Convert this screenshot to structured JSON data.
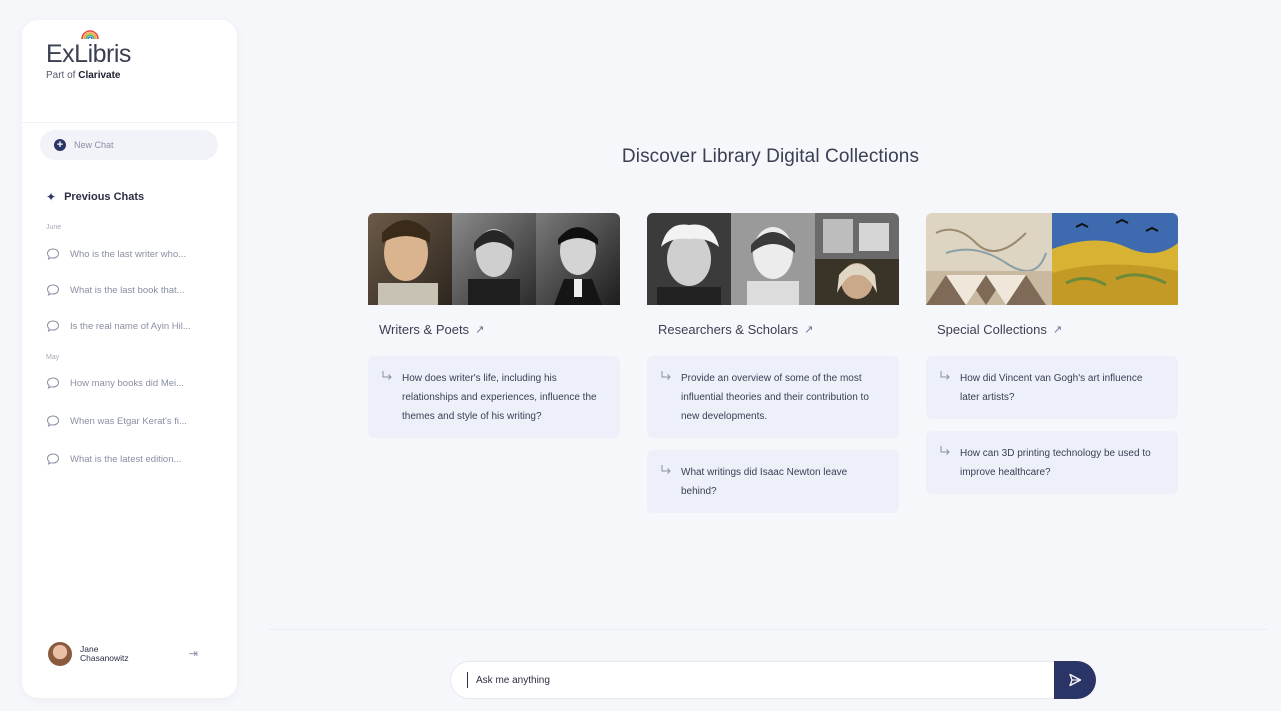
{
  "brand": {
    "logo_text": "ExLibris",
    "sub_prefix": "Part of",
    "sub_company": "Clarivate"
  },
  "sidebar": {
    "new_chat_label": "New Chat",
    "previous_chats_title": "Previous Chats",
    "groups": [
      {
        "label": "June",
        "items": [
          "Who is the last writer who...",
          "What is the last book that...",
          "Is the real name of Ayin Hil..."
        ]
      },
      {
        "label": "May",
        "items": [
          "How many books did Mei...",
          "When was Etgar Kerat's fi...",
          "What is the latest edition..."
        ]
      }
    ],
    "user": {
      "first_name": "Jane",
      "last_name": "Chasanowitz"
    }
  },
  "main": {
    "title": "Discover Library Digital Collections",
    "columns": [
      {
        "title": "Writers & Poets",
        "cards": [
          "How does writer's life, including his relationships and experiences, influence the themes and style of his writing?"
        ]
      },
      {
        "title": "Researchers & Scholars",
        "cards": [
          "Provide an overview of some of the most influential theories and their contribution to new developments.",
          "What writings did Isaac Newton leave behind?"
        ]
      },
      {
        "title": "Special Collections",
        "cards": [
          "How did Vincent van Gogh's art influence later artists?",
          "How can 3D printing technology be used to improve healthcare?"
        ]
      }
    ]
  },
  "composer": {
    "placeholder": "Ask me anything"
  },
  "colors": {
    "accent": "#2b3466",
    "card_bg": "#edf0f9",
    "page_bg": "#f6f7fb"
  }
}
